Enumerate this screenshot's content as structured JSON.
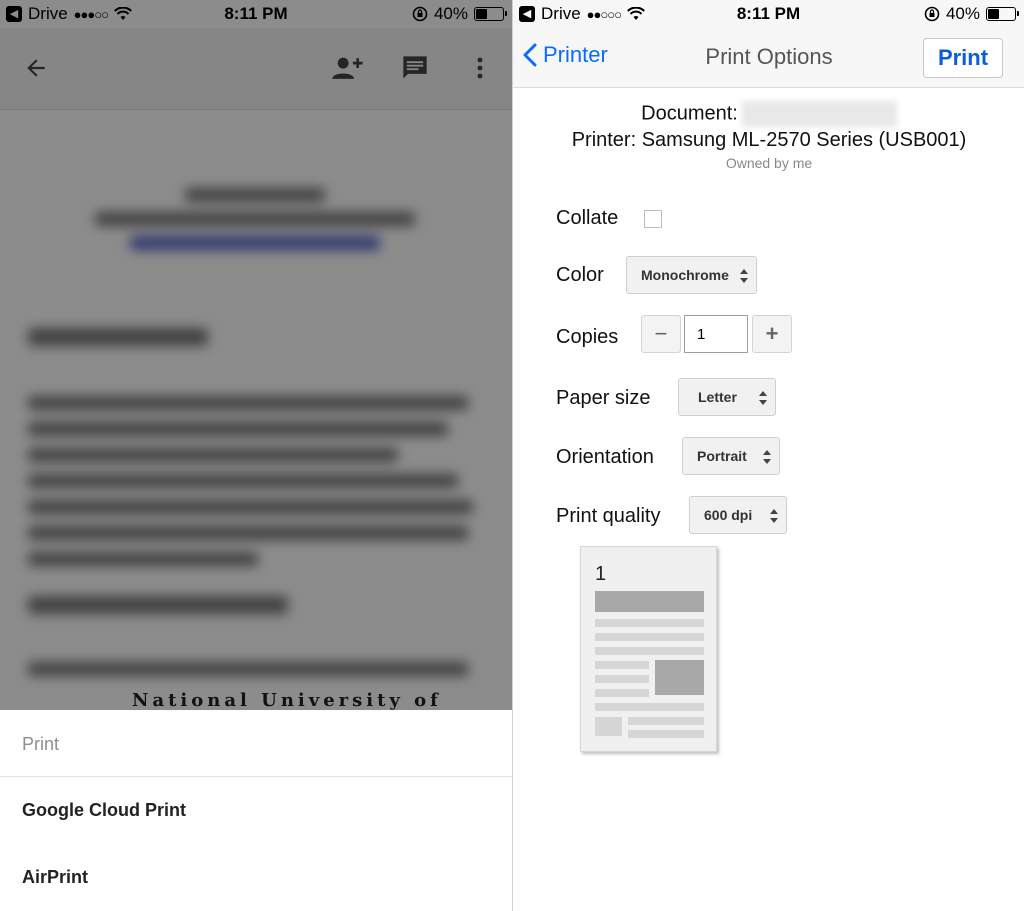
{
  "left": {
    "status": {
      "carrier": "Drive",
      "time": "8:11 PM",
      "battery_percent": "40%",
      "battery_level": 0.4
    },
    "toolbar": {
      "back_icon": "arrow-left-icon",
      "add_person_icon": "person-add-icon",
      "comment_icon": "comment-icon",
      "more_icon": "more-vert-icon"
    },
    "document_partial_text": "National University of Science",
    "print_sheet": {
      "title": "Print",
      "items": [
        "Google Cloud Print",
        "AirPrint"
      ]
    }
  },
  "right": {
    "status": {
      "carrier": "Drive",
      "time": "8:11 PM",
      "battery_percent": "40%",
      "battery_level": 0.4
    },
    "nav": {
      "back_label": "Printer",
      "title": "Print Options",
      "print_label": "Print"
    },
    "info": {
      "document_label": "Document:",
      "printer_line": "Printer: Samsung ML-2570 Series (USB001)",
      "owner": "Owned by me"
    },
    "options": {
      "collate_label": "Collate",
      "collate_checked": false,
      "color_label": "Color",
      "color_value": "Monochrome",
      "copies_label": "Copies",
      "copies_value": "1",
      "paper_label": "Paper size",
      "paper_value": "Letter",
      "orientation_label": "Orientation",
      "orientation_value": "Portrait",
      "quality_label": "Print quality",
      "quality_value": "600 dpi"
    },
    "preview": {
      "page_number": "1"
    },
    "colors": {
      "accent": "#0a6cff",
      "print_button": "#0a5ed8"
    }
  }
}
